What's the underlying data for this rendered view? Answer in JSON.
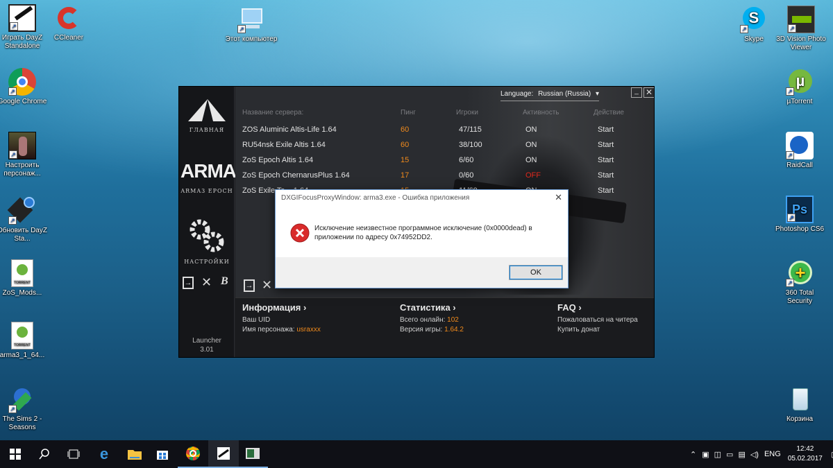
{
  "desktop": {
    "left_icons": [
      {
        "label": "Играть DayZ Standalone"
      },
      {
        "label": "Google Chrome"
      },
      {
        "label": "Настроить персонаж..."
      },
      {
        "label": "Обновить DayZ Sta..."
      },
      {
        "label": "ZoS_Mods..."
      },
      {
        "label": "arma3_1_64..."
      },
      {
        "label": "The Sims 2 - Seasons"
      }
    ],
    "ccleaner": {
      "label": "CCleaner"
    },
    "computer": {
      "label": "Этот компьютер"
    },
    "right_icons": [
      {
        "label": "Skype"
      },
      {
        "label": "3D Vision Photo Viewer"
      },
      {
        "label": "µTorrent"
      },
      {
        "label": "RaidCall"
      },
      {
        "label": "Photoshop CS6"
      },
      {
        "label": "360 Total Security"
      },
      {
        "label": "Корзина"
      }
    ],
    "torrent_badge": "TORRENT"
  },
  "launcher": {
    "language_label": "Language:",
    "language_value": "Russian (Russia)",
    "nav_home": "ГЛАВНАЯ",
    "nav_logo": "ARMA",
    "nav_logo_sub": "ARMA3 EPOCH",
    "nav_settings": "НАСТРОЙКИ",
    "version_label": "Launcher",
    "version_value": "3.01",
    "columns": {
      "name": "Название сервера:",
      "ping": "Пинг",
      "players": "Игроки",
      "activity": "Активность",
      "action": "Действие"
    },
    "servers": [
      {
        "name": "ZOS Aluminic Altis-Life 1.64",
        "ping": "60",
        "players": "47/115",
        "status": "ON",
        "action": "Start"
      },
      {
        "name": "RU54nsk Exile Altis 1.64",
        "ping": "60",
        "players": "38/100",
        "status": "ON",
        "action": "Start"
      },
      {
        "name": "ZoS Epoch Altis 1.64",
        "ping": "15",
        "players": "6/60",
        "status": "ON",
        "action": "Start"
      },
      {
        "name": "ZoS Epoch ChernarusPlus 1.64",
        "ping": "17",
        "players": "0/60",
        "status": "OFF",
        "action": "Start"
      },
      {
        "name": "ZoS Exile Ta... 1.64",
        "ping": "15",
        "players": "11/60",
        "status": "ON",
        "action": "Start"
      }
    ],
    "info": {
      "title": "Информация ›",
      "uid_label": "Ваш UID",
      "name_label": "Имя персонажа:",
      "name_value": "usraxxx"
    },
    "stats": {
      "title": "Статистика ›",
      "online_label": "Всего онлайн:",
      "online_value": "102",
      "version_label": "Версия игры:",
      "version_value": "1.64.2"
    },
    "faq": {
      "title": "FAQ ›",
      "report": "Пожаловаться на читера",
      "donate": "Купить донат"
    },
    "colors": {
      "accent": "#f08a1c",
      "off": "#e0281c"
    }
  },
  "dialog": {
    "title": "DXGIFocusProxyWindow: arma3.exe - Ошибка приложения",
    "message": "Исключение неизвестное программное исключение (0x0000dead) в приложении по адресу 0x74952DD2.",
    "ok": "OK"
  },
  "taskbar": {
    "lang": "ENG",
    "time": "12:42",
    "date": "05.02.2017"
  }
}
